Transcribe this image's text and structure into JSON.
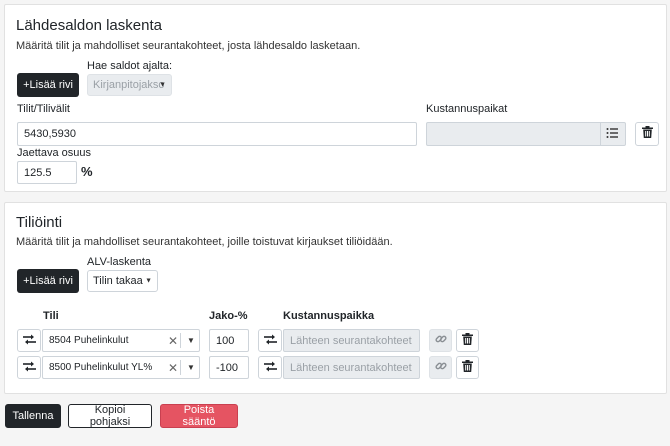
{
  "source_section": {
    "title": "Lähdesaldon laskenta",
    "description": "Määritä tilit ja mahdolliset seurantakohteet, josta lähdesaldo lasketaan.",
    "add_row_label": "+Lisää rivi",
    "fetch_balances_label": "Hae saldot ajalta:",
    "fetch_balances_value": "Kirjanpitojakso",
    "accounts_label": "Tilit/Tilivälit",
    "accounts_value": "5430,5930",
    "cost_centers_label": "Kustannuspaikat",
    "cost_centers_value": "",
    "share_label": "Jaettava osuus",
    "share_value": "125.5",
    "share_unit": "%"
  },
  "posting_section": {
    "title": "Tiliöinti",
    "description": "Määritä tilit ja mahdolliset seurantakohteet, joille toistuvat kirjaukset tiliöidään.",
    "add_row_label": "+Lisää rivi",
    "vat_label": "ALV-laskenta",
    "vat_value": "Tilin takaa",
    "columns": {
      "account": "Tili",
      "share": "Jako-%",
      "cost_center": "Kustannuspaikka"
    },
    "rows": [
      {
        "account": "8504 Puhelinkulut",
        "share": "100",
        "cost_center_placeholder": "Lähteen seurantakohteet"
      },
      {
        "account": "8500 Puhelinkulut YL%",
        "share": "-100",
        "cost_center_placeholder": "Lähteen seurantakohteet"
      }
    ]
  },
  "footer": {
    "save_label": "Tallenna",
    "copy_template_label": "Kopioi pohjaksi",
    "delete_rule_label": "Poista sääntö"
  },
  "colors": {
    "primary_dark": "#212529",
    "danger": "#e55462",
    "disabled_bg": "#e9ecef"
  }
}
